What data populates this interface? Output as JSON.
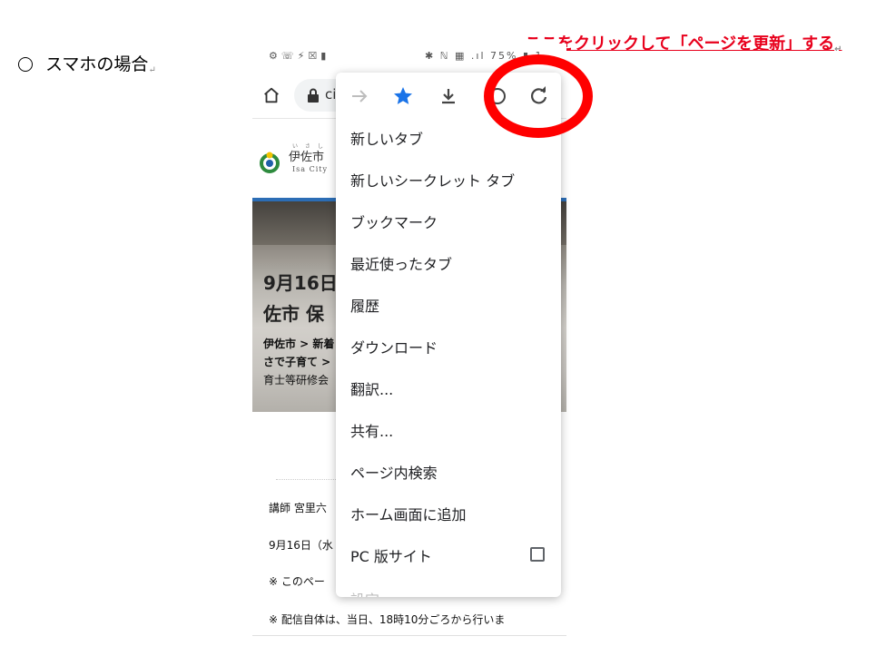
{
  "heading": {
    "mark": "○",
    "text": "スマホの場合",
    "return_mark": "↵"
  },
  "annotation": {
    "text": "ここをクリックして「ページを更新」する",
    "return_mark": "↵",
    "color": "#e8001c"
  },
  "phone": {
    "status_bar": {
      "left_icons": "⚙☏⚡☒▮",
      "right_text": "✱ ℕ ▦ .ıl 75% ▮ 1"
    },
    "address_bar": {
      "url_text": "ci"
    },
    "site": {
      "name": "伊佐市",
      "name_ruby": "い さ し",
      "name_en": "Isa City"
    },
    "hero": {
      "title_line1": "9月16日",
      "title_line2": "佐市 保",
      "breadcrumb_line1": "伊佐市 > 新着",
      "breadcrumb_line2": "さで子育て >",
      "breadcrumb_line3": "育士等研修会"
    },
    "body_lines": [
      "講師 宮里六",
      "9月16日（水",
      "※ このペー",
      "※ 配信自体は、当日、18時10分ごろから行いま"
    ]
  },
  "menu": {
    "toolbar_icons": [
      "forward-icon",
      "star-icon",
      "download-icon",
      "info-icon",
      "refresh-icon"
    ],
    "star_color": "#1a73e8",
    "items": [
      "新しいタブ",
      "新しいシークレット タブ",
      "ブックマーク",
      "最近使ったタブ",
      "履歴",
      "ダウンロード",
      "翻訳...",
      "共有...",
      "ページ内検索",
      "ホーム画面に追加",
      "PC 版サイト",
      "設定"
    ]
  },
  "highlight_color": "#ff0000"
}
